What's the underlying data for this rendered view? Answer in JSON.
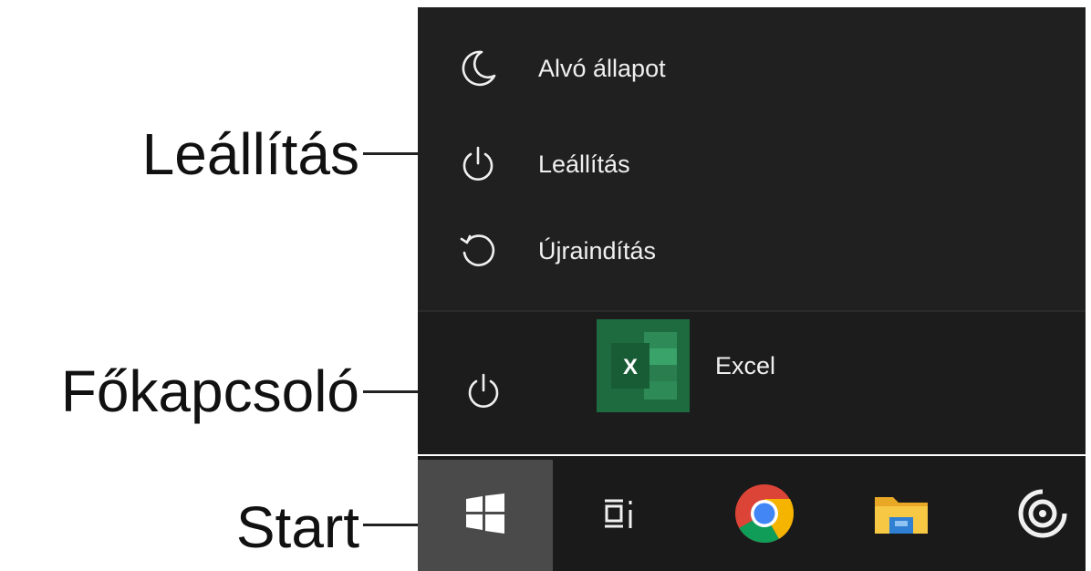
{
  "callouts": {
    "shutdown": "Leállítás",
    "power": "Főkapcsoló",
    "start": "Start"
  },
  "power_menu": {
    "items": [
      {
        "label": "Alvó állapot",
        "icon": "moon-icon"
      },
      {
        "label": "Leállítás",
        "icon": "power-icon"
      },
      {
        "label": "Újraindítás",
        "icon": "restart-icon"
      }
    ]
  },
  "start_menu": {
    "power_button_icon": "power-icon",
    "app": {
      "label": "Excel",
      "icon_letter": "X",
      "color": "#1d6b3f"
    }
  },
  "taskbar": {
    "start_icon": "windows-icon",
    "items": [
      {
        "icon": "task-view-icon"
      },
      {
        "icon": "chrome-icon"
      },
      {
        "icon": "file-explorer-icon"
      },
      {
        "icon": "groove-music-icon"
      }
    ]
  },
  "colors": {
    "menu_bg": "#202020",
    "taskbar_bg": "#1a1a1a",
    "start_button_bg": "#4a4a4a",
    "text": "#f0f0f0"
  }
}
